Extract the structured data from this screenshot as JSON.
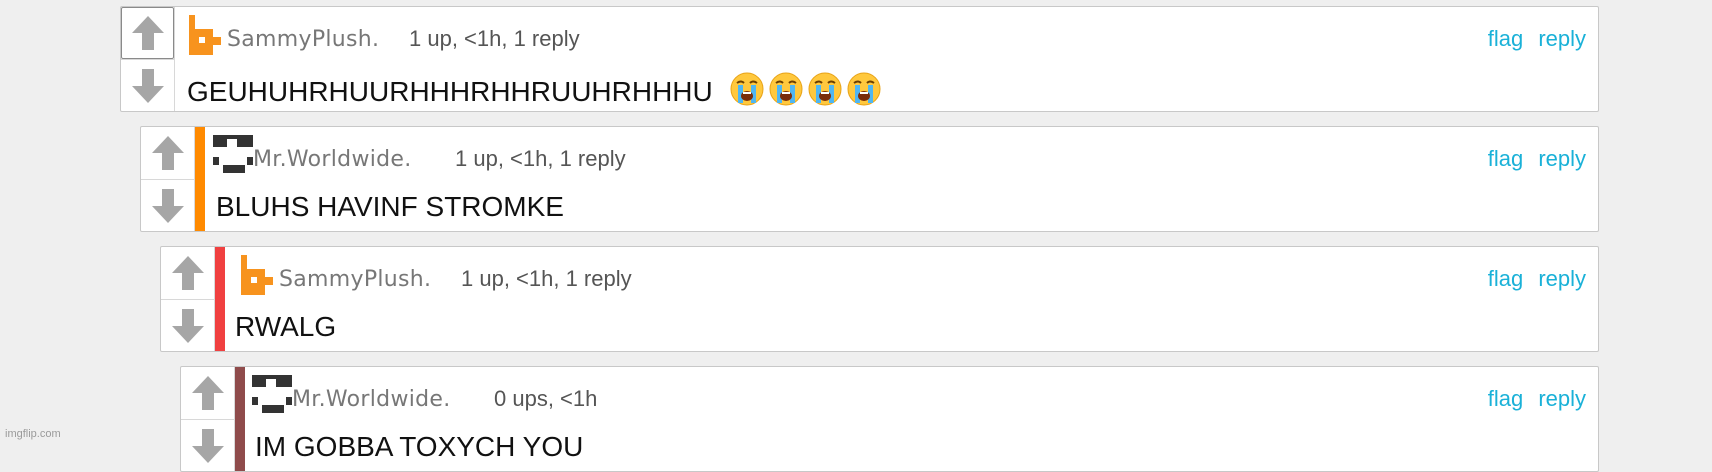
{
  "colors": {
    "link": "#1ab1d8",
    "depth_bar_1": "#ff8a00",
    "depth_bar_2": "#f04040",
    "depth_bar_3": "#8f4b4b",
    "sammy_avatar": "#f7931e",
    "worldwide_avatar": "#333333"
  },
  "comments": [
    {
      "username": "SammyPlush.",
      "avatar_icon": "orange-blocky-avatar-icon",
      "stats": "1 up, <1h, 1 reply",
      "flag_label": "flag",
      "reply_label": "reply",
      "text": "GEUHUHRHUURHHHRHHRUUHRHHHU",
      "emoji": [
        "loudly-crying-face-icon",
        "loudly-crying-face-icon",
        "loudly-crying-face-icon",
        "loudly-crying-face-icon"
      ]
    },
    {
      "username": "Mr.Worldwide.",
      "avatar_icon": "sunglasses-face-avatar-icon",
      "stats": "1 up, <1h, 1 reply",
      "flag_label": "flag",
      "reply_label": "reply",
      "text": "BLUHS HAVINF STROMKE"
    },
    {
      "username": "SammyPlush.",
      "avatar_icon": "orange-blocky-avatar-icon",
      "stats": "1 up, <1h, 1 reply",
      "flag_label": "flag",
      "reply_label": "reply",
      "text": "RWALG"
    },
    {
      "username": "Mr.Worldwide.",
      "avatar_icon": "sunglasses-face-avatar-icon",
      "stats": "0 ups, <1h",
      "flag_label": "flag",
      "reply_label": "reply",
      "text": "IM GOBBA TOXYCH YOU"
    }
  ],
  "watermark": "imgflip.com"
}
